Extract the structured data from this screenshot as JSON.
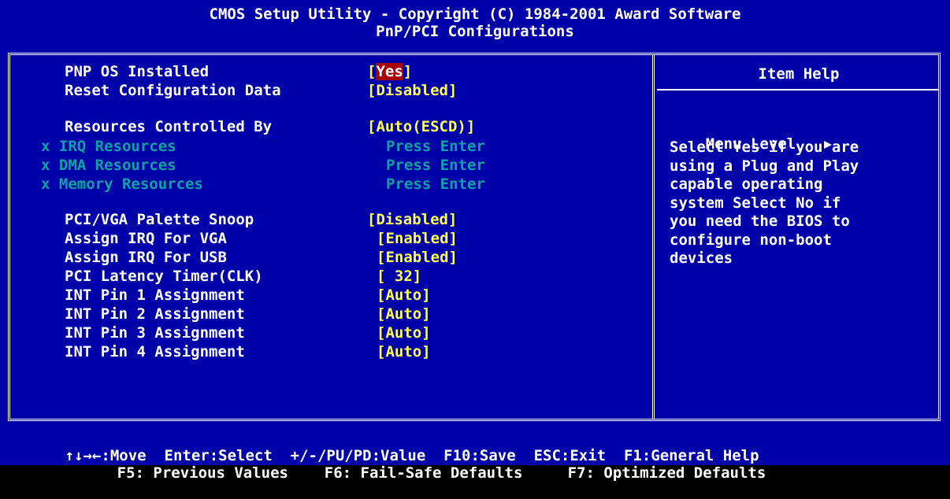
{
  "header": {
    "title": "CMOS Setup Utility - Copyright (C) 1984-2001 Award Software",
    "subtitle": "PnP/PCI Configurations"
  },
  "settings": [
    {
      "label": "PNP OS Installed",
      "value": "Yes",
      "selected": true,
      "disabled": false,
      "prefix": ""
    },
    {
      "label": "Reset Configuration Data",
      "value": "Disabled",
      "selected": false,
      "disabled": false,
      "prefix": ""
    },
    {
      "label": "Resources Controlled By",
      "value": "Auto(ESCD)",
      "selected": false,
      "disabled": false,
      "prefix": ""
    },
    {
      "label": "IRQ Resources",
      "value": "Press Enter",
      "selected": false,
      "disabled": true,
      "prefix": "x"
    },
    {
      "label": "DMA Resources",
      "value": "Press Enter",
      "selected": false,
      "disabled": true,
      "prefix": "x"
    },
    {
      "label": "Memory Resources",
      "value": "Press Enter",
      "selected": false,
      "disabled": true,
      "prefix": "x"
    },
    {
      "label": "PCI/VGA Palette Snoop",
      "value": "Disabled",
      "selected": false,
      "disabled": false,
      "prefix": ""
    },
    {
      "label": "Assign IRQ For VGA",
      "value": "Enabled",
      "selected": false,
      "disabled": false,
      "prefix": ""
    },
    {
      "label": "Assign IRQ For USB",
      "value": "Enabled",
      "selected": false,
      "disabled": false,
      "prefix": ""
    },
    {
      "label": "PCI Latency Timer(CLK)",
      "value": " 32",
      "selected": false,
      "disabled": false,
      "prefix": ""
    },
    {
      "label": "INT Pin 1 Assignment",
      "value": "Auto",
      "selected": false,
      "disabled": false,
      "prefix": ""
    },
    {
      "label": "INT Pin 2 Assignment",
      "value": "Auto",
      "selected": false,
      "disabled": false,
      "prefix": ""
    },
    {
      "label": "INT Pin 3 Assignment",
      "value": "Auto",
      "selected": false,
      "disabled": false,
      "prefix": ""
    },
    {
      "label": "INT Pin 4 Assignment",
      "value": "Auto",
      "selected": false,
      "disabled": false,
      "prefix": ""
    }
  ],
  "help": {
    "title": "Item Help",
    "menu_level_label": "Menu Level",
    "menu_level_icon": "right-triangle-icon",
    "text_lines": [
      "Select Yes if you are",
      "using a Plug and Play",
      "capable operating",
      "system Select No if",
      "you need the BIOS to",
      "configure non-boot",
      "devices"
    ]
  },
  "footer": {
    "line1": {
      "move": ":Move",
      "move_icon": "arrow-keys-icon",
      "select": "Enter:Select",
      "value": "+/-/PU/PD:Value",
      "save": "F10:Save",
      "exit": "ESC:Exit",
      "help": "F1:General Help"
    },
    "line2": {
      "f5": "F5: Previous Values",
      "f6": "F6: Fail-Safe Defaults",
      "f7": "F7: Optimized Defaults"
    }
  },
  "colors": {
    "background": "#0000a8",
    "value": "#ffff55",
    "disabled": "#0aa2a2",
    "highlight": "#a80000",
    "text": "#ffffff"
  }
}
